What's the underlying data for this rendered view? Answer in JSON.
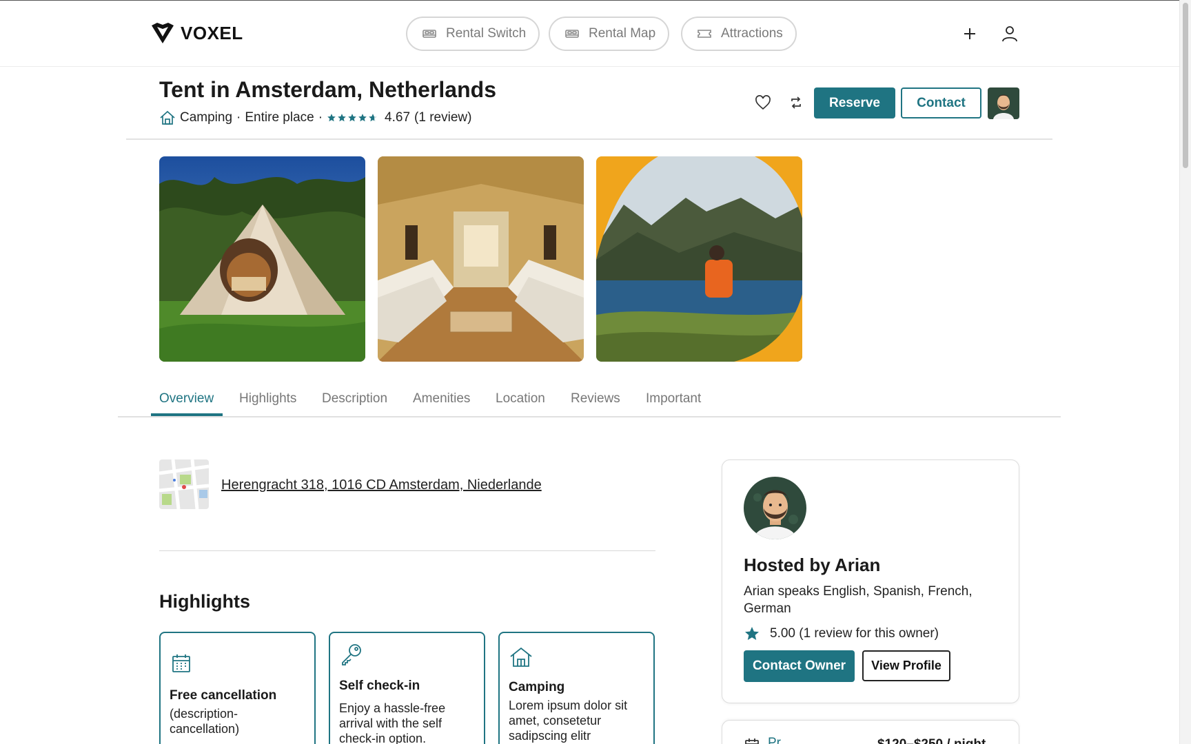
{
  "brand": {
    "name": "VOXEL"
  },
  "nav": {
    "pills": [
      {
        "label": "Rental Switch",
        "icon": "bed-icon"
      },
      {
        "label": "Rental Map",
        "icon": "bed-icon"
      },
      {
        "label": "Attractions",
        "icon": "ticket-icon"
      }
    ]
  },
  "listing": {
    "title": "Tent in Amsterdam, Netherlands",
    "category": "Camping",
    "sep1": "·",
    "place_type": "Entire place",
    "sep2": "·",
    "rating": "4.67",
    "review_count": "(1 review)",
    "stars": 4.67
  },
  "actions": {
    "reserve_label": "Reserve",
    "contact_label": "Contact"
  },
  "tabs": [
    {
      "label": "Overview",
      "active": true
    },
    {
      "label": "Highlights"
    },
    {
      "label": "Description"
    },
    {
      "label": "Amenities"
    },
    {
      "label": "Location"
    },
    {
      "label": "Reviews"
    },
    {
      "label": "Important"
    }
  ],
  "address": "Herengracht 318, 1016 CD Amsterdam, Niederlande",
  "highlights": {
    "title": "Highlights",
    "items": [
      {
        "title": "Free cancellation",
        "desc": "(description-cancellation)",
        "icon": "calendar-icon"
      },
      {
        "title": "Self check-in",
        "desc": "Enjoy a hassle-free arrival with the self check-in option.",
        "icon": "key-icon"
      },
      {
        "title": "Camping",
        "desc": "Lorem ipsum dolor sit amet, consetetur sadipscing elitr",
        "icon": "house-icon"
      }
    ]
  },
  "host": {
    "name": "Hosted by Arian",
    "languages": "Arian speaks English, Spanish, French, German",
    "rating": "5.00 (1 review for this owner)",
    "contact_owner_label": "Contact Owner",
    "view_profile_label": "View Profile"
  },
  "price": {
    "label": "Pr...",
    "range": "$120–$250 / night"
  },
  "colors": {
    "accent": "#1f7482",
    "border": "#e2e2e2"
  }
}
